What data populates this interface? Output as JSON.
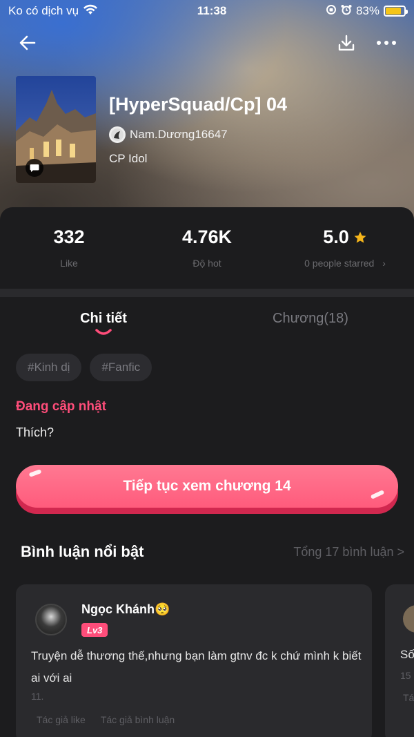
{
  "status_bar": {
    "carrier": "Ko có dịch vụ",
    "time": "11:38",
    "battery_percent": "83%",
    "battery_level": 0.83
  },
  "nav": {
    "back_icon": "arrow-left-icon",
    "download_icon": "download-icon",
    "more_icon": "more-horizontal-icon"
  },
  "book": {
    "title": "[HyperSquad/Cp] 04",
    "author": "Nam.Dương16647",
    "genre": "CP Idol"
  },
  "stats": [
    {
      "value": "332",
      "label": "Like"
    },
    {
      "value": "4.76K",
      "label": "Độ hot"
    },
    {
      "value": "5.0",
      "label": "0 people starred",
      "chevron": "›"
    }
  ],
  "tabs": [
    {
      "label": "Chi tiết",
      "active": true
    },
    {
      "label": "Chương(18)",
      "active": false
    }
  ],
  "tags": [
    "#Kinh dị",
    "#Fanfic"
  ],
  "update_status": "Đang cập nhật",
  "description": "Thích?",
  "continue_button": "Tiếp tục xem chương 14",
  "comments": {
    "title": "Bình luận nổi bật",
    "total": "Tổng 17 bình luận >",
    "items": [
      {
        "name": "Ngọc Khánh🥺",
        "level": "Lv3",
        "text": "Truyện dễ thương thế,nhưng bạn làm gtnv đc k chứ mình k biết ai với ai",
        "date": "11.",
        "action_like": "Tác giả like",
        "action_reply": "Tác giả bình luận"
      },
      {
        "text_partial": "Số",
        "num_partial": "15",
        "t_partial": "Tá"
      }
    ]
  },
  "colors": {
    "accent": "#ff4d7a",
    "background": "#1c1c1e",
    "star": "#f5b51b"
  }
}
